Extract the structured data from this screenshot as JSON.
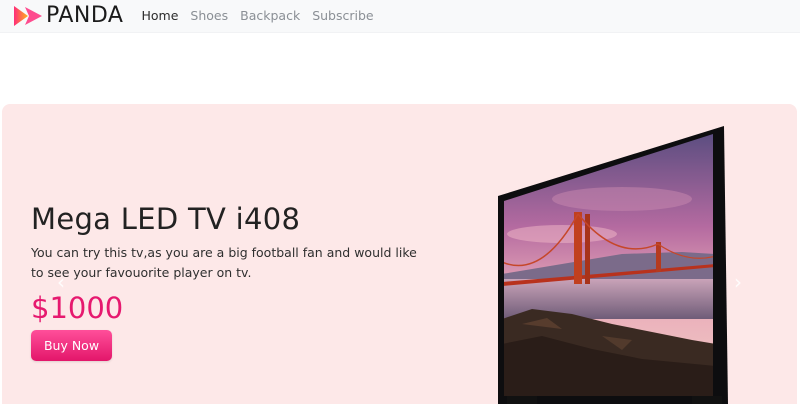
{
  "navbar": {
    "brand": "PANDA",
    "links": [
      {
        "label": "Home",
        "active": true
      },
      {
        "label": "Shoes",
        "active": false
      },
      {
        "label": "Backpack",
        "active": false
      },
      {
        "label": "Subscribe",
        "active": false
      }
    ]
  },
  "carousel": {
    "slide": {
      "title": "Mega LED TV i408",
      "description": "You can try this tv,as you are a big football fan and would like to see your favouorite player on tv.",
      "price": "$1000",
      "button_label": "Buy Now",
      "image": "led-tv-golden-gate-bridge"
    },
    "prev_icon": "chevron-left-icon",
    "next_icon": "chevron-right-icon"
  },
  "colors": {
    "navbar_bg": "#f8f9fa",
    "hero_bg": "#fde8e8",
    "accent": "#e6196f",
    "logo_gradient": [
      "#ff2d7a",
      "#ffb21a"
    ]
  }
}
